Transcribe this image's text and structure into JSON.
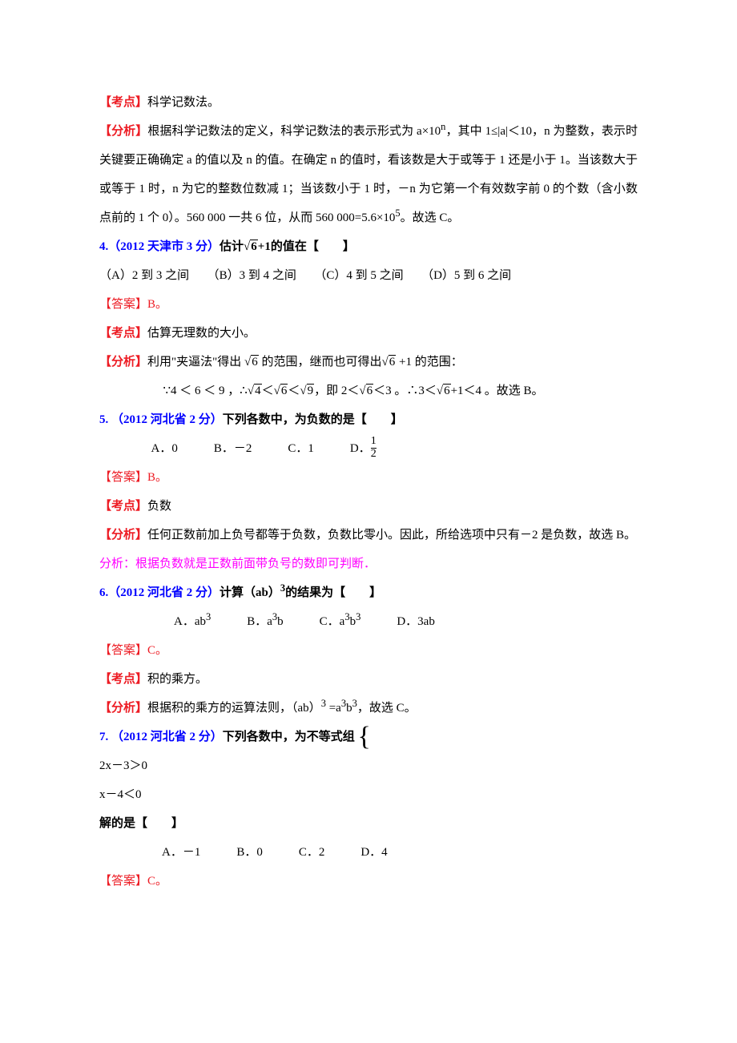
{
  "labels": {
    "kaodian": "【考点】",
    "fenxi": "【分析】",
    "daan": "【答案】"
  },
  "sec_a": {
    "kaodian_text": "科学记数法。",
    "fenxi_part1": "根据科学记数法的定义，科学记数法的表示形式为 a×10",
    "fenxi_sup1": "n",
    "fenxi_part2": "，其中 1≤|a|＜10，n 为整数，表示时关键要正确确定 a 的值以及 n 的值。在确定 n 的值时，看该数是大于或等于 1 还是小于 1。当该数大于或等于 1 时，n 为它的整数位数减 1；当该数小于 1 时，－n 为它第一个有效数字前 0 的个数（含小数点前的 1 个 0）。560 000 一共 6 位，从而 560 000=5.6×10",
    "fenxi_sup2": "5",
    "fenxi_part3": "。故选 C。"
  },
  "q4": {
    "title_src": "4.（2012 天津市 3 分）",
    "stem_a": "估计",
    "sqrt_val": "6",
    "stem_b": "+1的值在【　　】",
    "opts": "（A）2 到 3 之间　　（B）3 到 4 之间　　（C）4 到 5 之间　　（D）5 到 6 之间",
    "daan_val": "B。",
    "kaodian_text": "估算无理数的大小。",
    "fx_a": "利用\"夹逼法\"得出 ",
    "fx_b": " 的范围，继而也可得出",
    "fx_c": " +1 的范围：",
    "line2_a": "∵4 ＜ 6 ＜ 9 ，∴",
    "line2_b": "＜",
    "line2_c": "＜",
    "line2_d": "，即 2＜",
    "line2_e": "＜3 。∴3＜",
    "line2_f": "+1＜4 。故选 B。",
    "sqrt4": "4",
    "sqrt9": "9"
  },
  "q5": {
    "title_src": "5. （2012 河北省 2 分）",
    "stem": "下列各数中，为负数的是【　　】",
    "opts_a": "A．0　　　B．－2　　　C．1　　　D．",
    "frac_num": "1",
    "frac_den": "2",
    "daan_val": "B。",
    "kaodian_text": "负数",
    "fenxi_text": "任何正数前加上负号都等于负数，负数比零小。因此，所给选项中只有－2 是负数，故选 B。",
    "extra": "分析：根据负数就是正数前面带负号的数即可判断．"
  },
  "q6": {
    "title_src": "6.（2012 河北省 2 分）",
    "stem_a": "计算（ab）",
    "stem_sup": "3",
    "stem_b": "的结果为【　　】",
    "opt_a_pre": "A．ab",
    "opt_a_sup": "3",
    "opt_b_pre": "　　　B．a",
    "opt_b_sup": "3",
    "opt_b_post": "b",
    "opt_c_pre": "　　　C．a",
    "opt_c_sup1": "3",
    "opt_c_mid": "b",
    "opt_c_sup2": "3",
    "opt_d": "　　　D．3ab",
    "daan_val": "C。",
    "kaodian_text": "积的乘方。",
    "fenxi_a": "根据积的乘方的运算法则，（ab）",
    "fenxi_sup_a": "3",
    "fenxi_b": " =a",
    "fenxi_sup_b": "3",
    "fenxi_c": "b",
    "fenxi_sup_c": "3",
    "fenxi_d": "，故选 C。"
  },
  "q7": {
    "title_src": "7. （2012 河北省 2 分）",
    "stem_a": "下列各数中，为不等式组 ",
    "sys_line1": "2x－3＞0",
    "sys_line2": "x－4＜0",
    "stem_b": " 解的是【　　】",
    "opts": "A．－1　　　B．0　　　C．2　　　D．4",
    "daan_val": "C。"
  }
}
